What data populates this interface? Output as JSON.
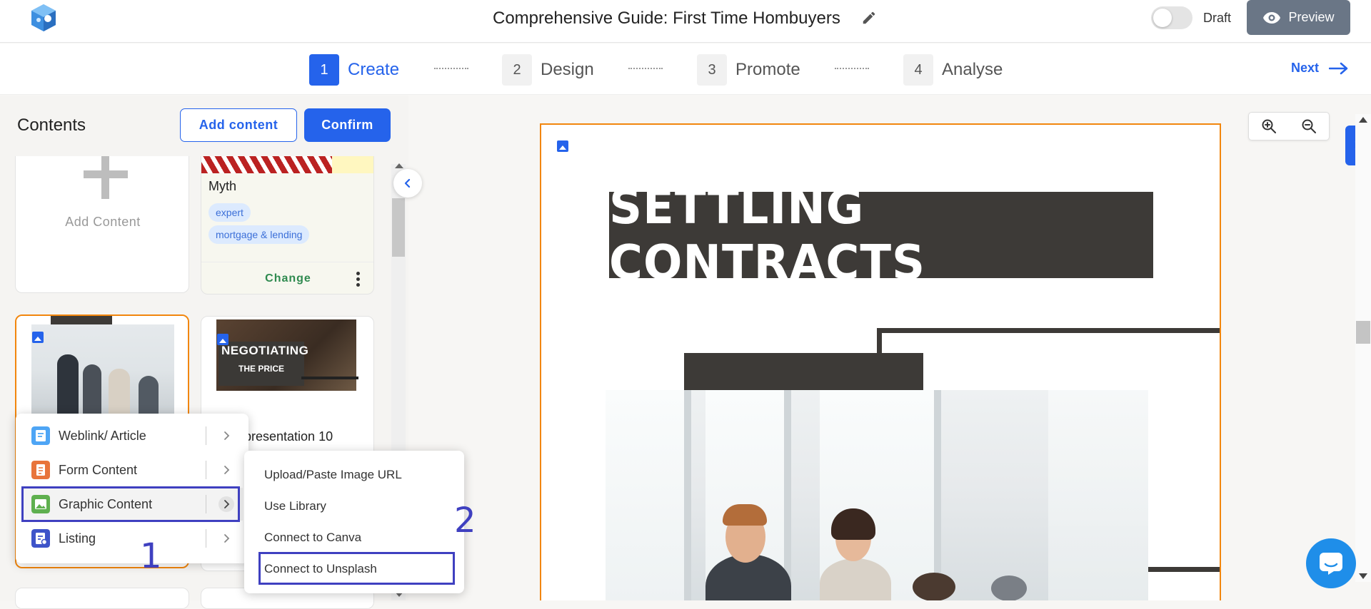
{
  "header": {
    "doc_title": "Comprehensive Guide: First Time Hombuyers",
    "draft_label": "Draft",
    "preview_label": "Preview"
  },
  "stepper": {
    "steps": [
      {
        "num": "1",
        "label": "Create",
        "active": true
      },
      {
        "num": "2",
        "label": "Design",
        "active": false
      },
      {
        "num": "3",
        "label": "Promote",
        "active": false
      },
      {
        "num": "4",
        "label": "Analyse",
        "active": false
      }
    ],
    "next_label": "Next"
  },
  "contents_panel": {
    "title": "Contents",
    "add_content_button": "Add content",
    "confirm_button": "Confirm",
    "add_card_label": "Add Content",
    "myth_card": {
      "title": "Myth",
      "tags": [
        "expert",
        "mortgage & lending"
      ],
      "change_label": "Change"
    },
    "negotiating_card": {
      "thumb_line1": "NEGOTIATING",
      "thumb_line2": "THE PRICE",
      "title": "presentation 10"
    }
  },
  "context_menu": {
    "items": [
      {
        "label": "Weblink/ Article",
        "icon": "weblink-icon",
        "color": "#4ea5f5"
      },
      {
        "label": "Form Content",
        "icon": "form-icon",
        "color": "#e8743b"
      },
      {
        "label": "Graphic Content",
        "icon": "graphic-icon",
        "color": "#5fb04f"
      },
      {
        "label": "Listing",
        "icon": "listing-icon",
        "color": "#3e54c9"
      }
    ]
  },
  "submenu": {
    "items": [
      "Upload/Paste Image URL",
      "Use Library",
      "Connect to Canva",
      "Connect to Unsplash"
    ]
  },
  "annotations": {
    "marker_1": "1",
    "marker_2": "2",
    "color": "#3f40c0"
  },
  "slide": {
    "title": "SETTLING CONTRACTS"
  },
  "colors": {
    "accent": "#2563eb",
    "selection": "#f2860d",
    "preview_button": "#6a7686",
    "chat": "#1f8ee9"
  }
}
